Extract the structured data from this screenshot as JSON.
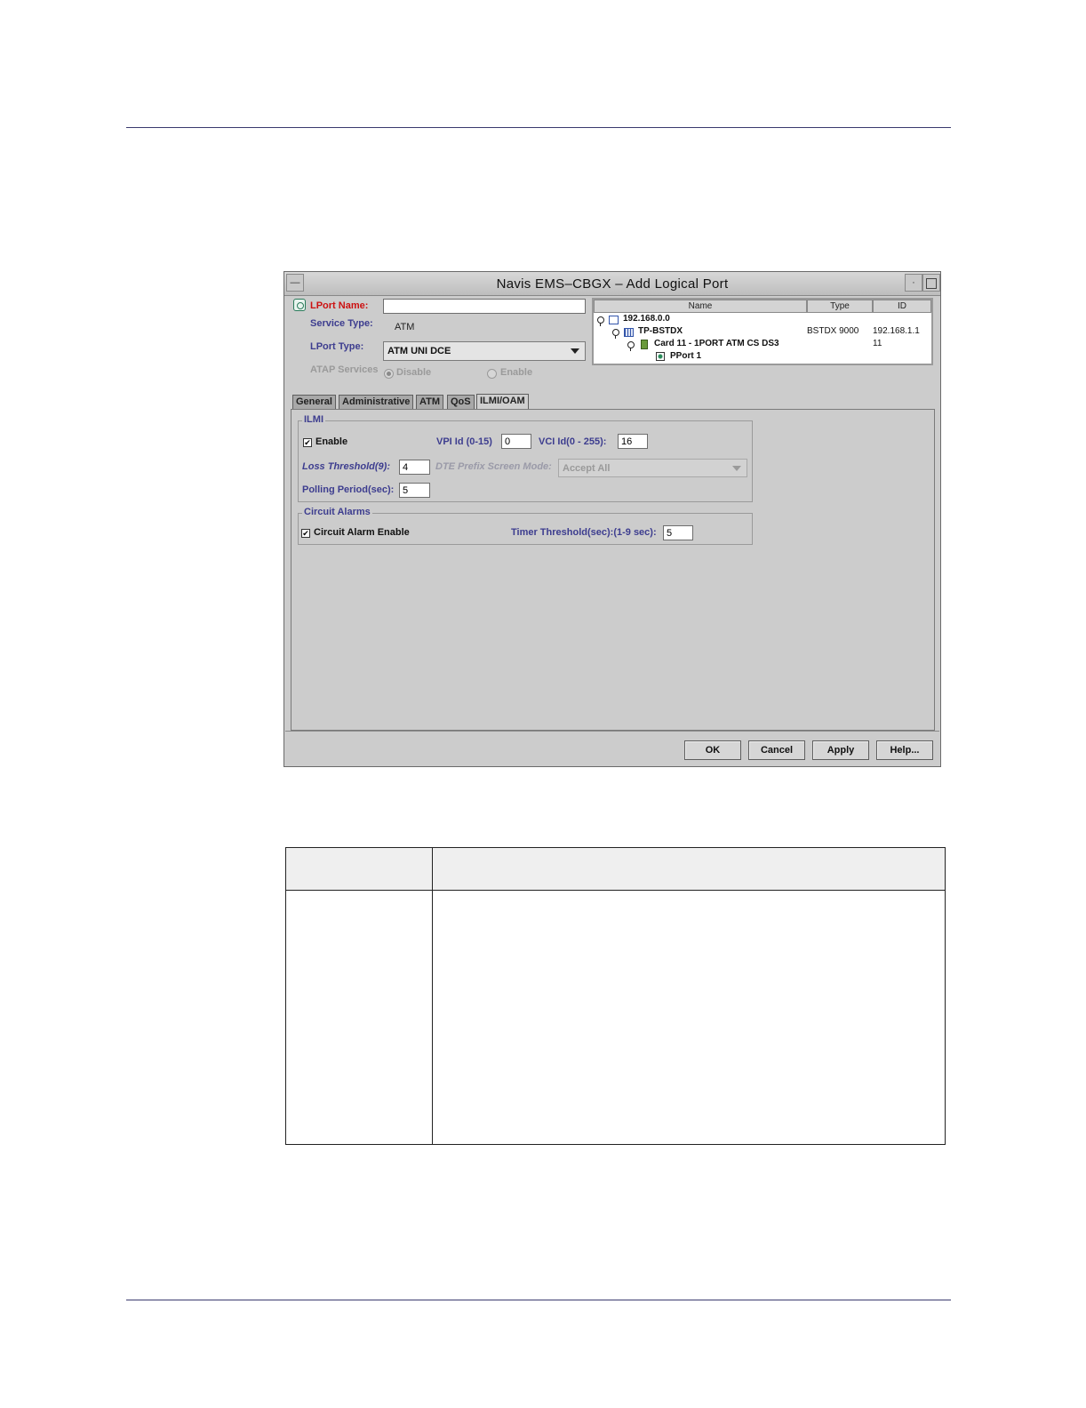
{
  "window": {
    "title": "Navis EMS–CBGX – Add Logical Port",
    "minimize_glyph": "—",
    "restore_glyph": "·"
  },
  "form": {
    "lport_name_label": "LPort Name:",
    "lport_name_value": "",
    "service_type_label": "Service Type:",
    "service_type_value": "ATM",
    "lport_type_label": "LPort Type:",
    "lport_type_value": "ATM UNI DCE",
    "atap_label": "ATAP Services",
    "atap_disable": "Disable",
    "atap_enable": "Enable",
    "atap_selected": "Disable"
  },
  "tree": {
    "columns": [
      "Name",
      "Type",
      "ID"
    ],
    "rows": [
      {
        "name": "192.168.0.0",
        "type": "",
        "id": ""
      },
      {
        "name": "TP-BSTDX",
        "type": "BSTDX 9000",
        "id": "192.168.1.1"
      },
      {
        "name": "Card 11 - 1PORT ATM CS DS3",
        "type": "",
        "id": "11"
      },
      {
        "name": "PPort 1",
        "type": "",
        "id": ""
      }
    ]
  },
  "tabs": {
    "items": [
      "General",
      "Administrative",
      "ATM",
      "QoS",
      "ILMI/OAM"
    ],
    "active": "ILMI/OAM"
  },
  "ilmi": {
    "group_title": "ILMI",
    "enable_label": "Enable",
    "enable_checked": true,
    "vpi_label": "VPI Id (0-15)",
    "vpi_value": "0",
    "vci_label": "VCI Id(0 - 255):",
    "vci_value": "16",
    "loss_label": "Loss Threshold(9):",
    "loss_value": "4",
    "dte_label": "DTE Prefix Screen Mode:",
    "dte_value": "Accept All",
    "polling_label": "Polling Period(sec):",
    "polling_value": "5"
  },
  "circuit_alarms": {
    "group_title": "Circuit Alarms",
    "enable_label": "Circuit Alarm Enable",
    "enable_checked": true,
    "timer_label": "Timer Threshold(sec):(1-9 sec):",
    "timer_value": "5"
  },
  "buttons": {
    "ok": "OK",
    "cancel": "Cancel",
    "apply": "Apply",
    "help": "Help..."
  },
  "check_glyph": "✔",
  "colors": {
    "required_label": "#cc1111",
    "field_label": "#3d3d8f",
    "window_bg": "#cccccc"
  }
}
